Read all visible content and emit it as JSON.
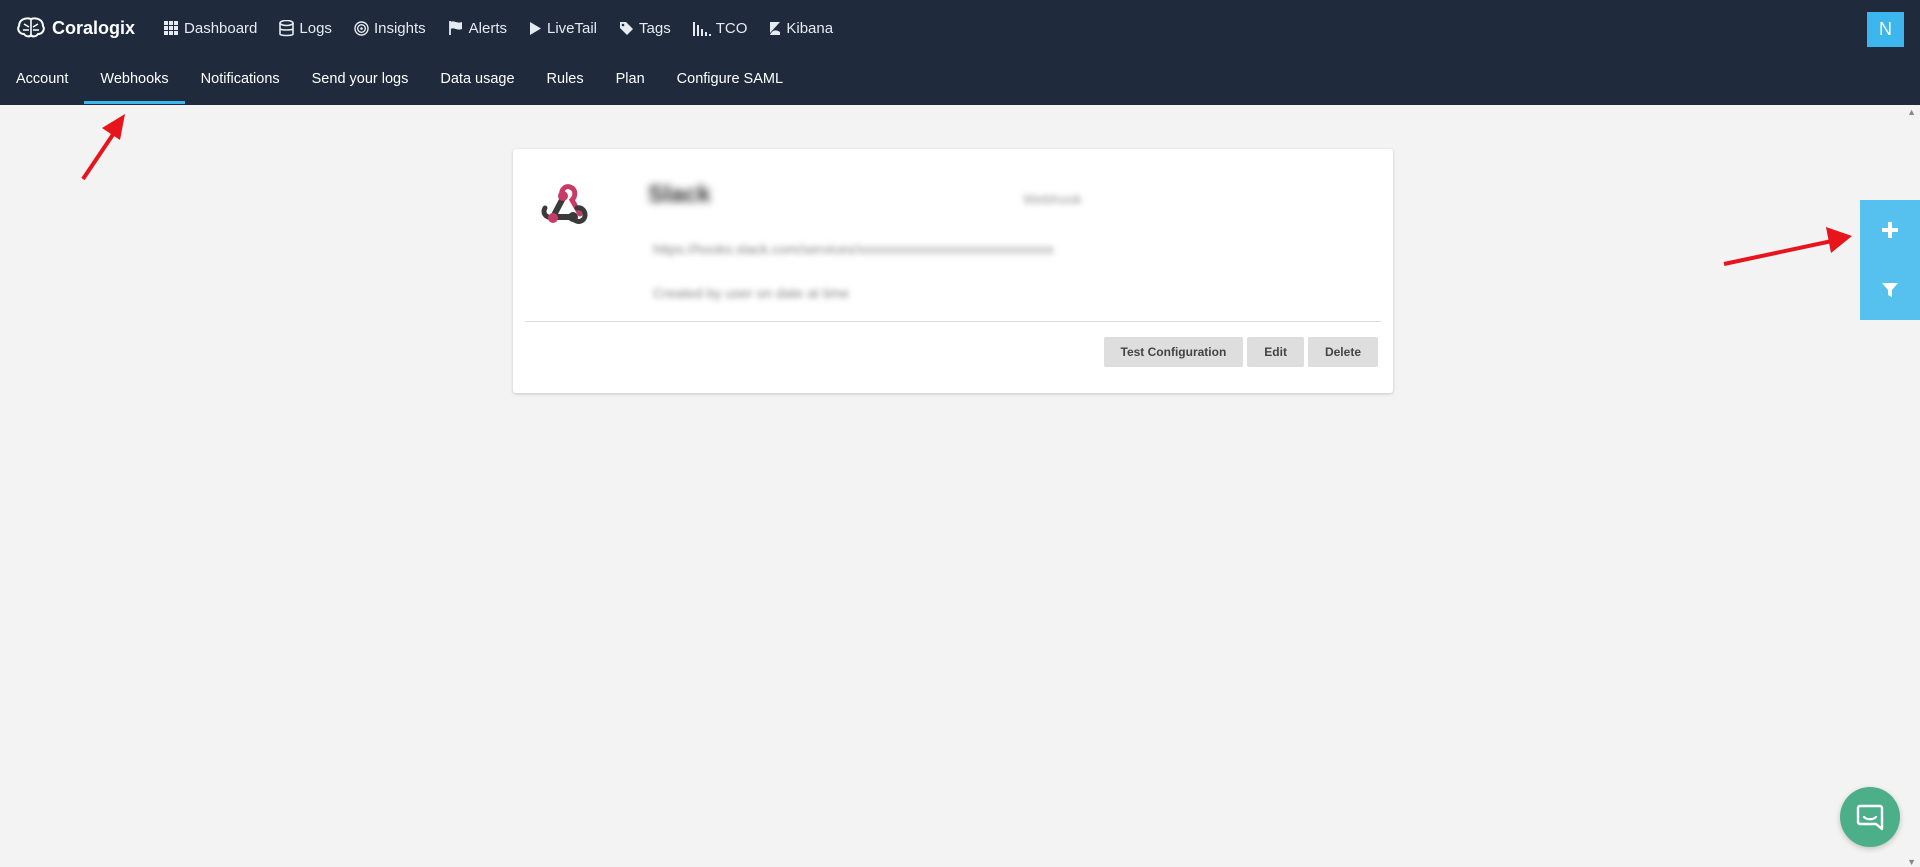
{
  "brand": {
    "name": "Coralogix"
  },
  "main_nav": [
    {
      "label": "Dashboard",
      "icon": "grid-icon"
    },
    {
      "label": "Logs",
      "icon": "database-icon"
    },
    {
      "label": "Insights",
      "icon": "target-icon"
    },
    {
      "label": "Alerts",
      "icon": "flag-icon"
    },
    {
      "label": "LiveTail",
      "icon": "play-icon"
    },
    {
      "label": "Tags",
      "icon": "tag-icon"
    },
    {
      "label": "TCO",
      "icon": "bars-icon"
    },
    {
      "label": "Kibana",
      "icon": "kibana-icon"
    }
  ],
  "user": {
    "initial": "N"
  },
  "sub_nav": {
    "active": "Webhooks",
    "items": [
      "Account",
      "Webhooks",
      "Notifications",
      "Send your logs",
      "Data usage",
      "Rules",
      "Plan",
      "Configure SAML"
    ]
  },
  "webhook_card": {
    "name": "Slack",
    "meta": "Webhook",
    "line1": "https://hooks.slack.com/services/xxxxxxxxxxxxxxxxxxxxxxxxxxxx",
    "line2": "Created by user on date at time",
    "actions": {
      "test": "Test Configuration",
      "edit": "Edit",
      "delete": "Delete"
    }
  },
  "colors": {
    "header": "#1f2a3c",
    "accent": "#3cb6ec",
    "side_bar": "#56c1ef",
    "annotation": "#e8141c",
    "chat": "#4caf8a"
  }
}
